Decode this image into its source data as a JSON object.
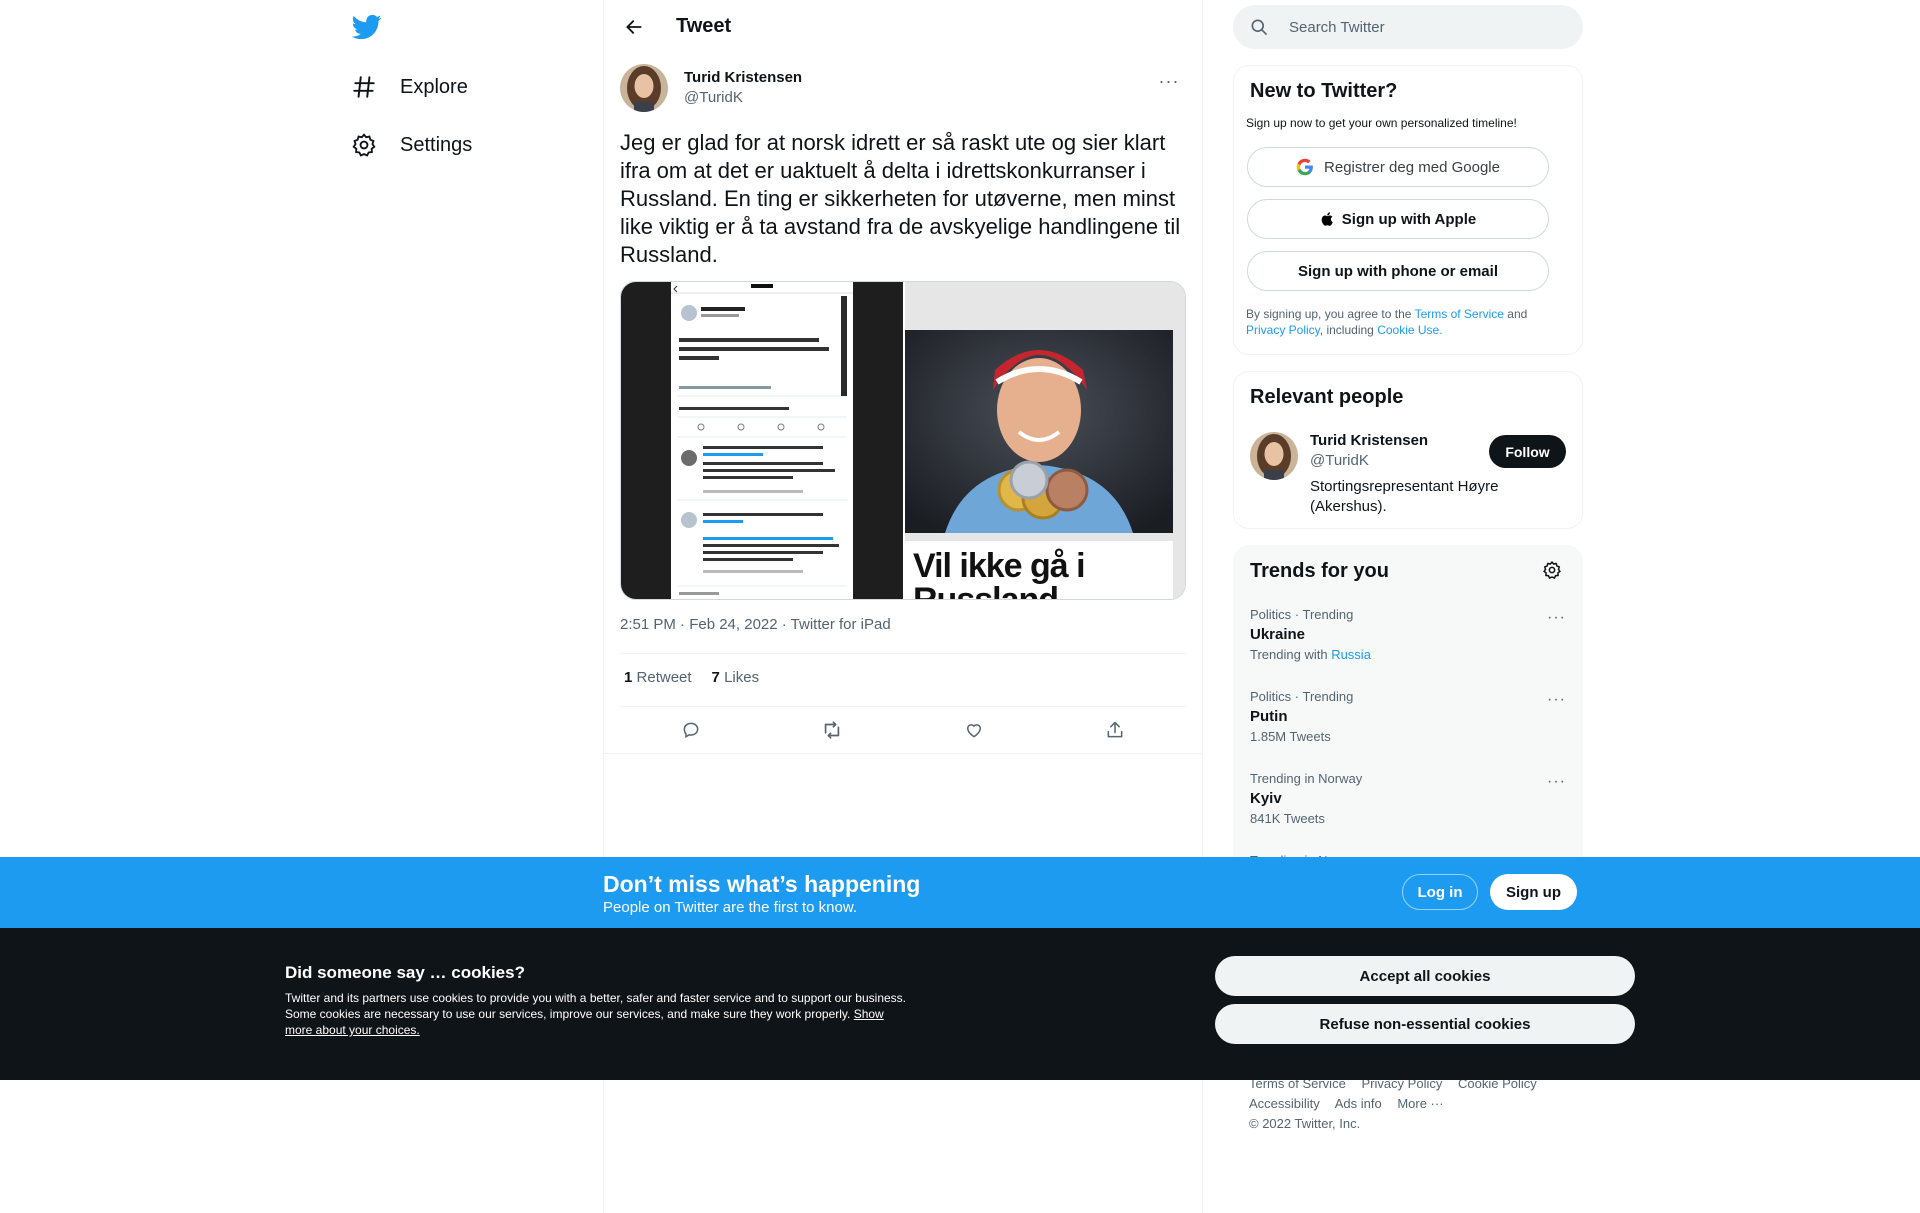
{
  "nav": {
    "logo": "twitter-bird-icon",
    "items": [
      {
        "label": "Explore",
        "icon": "hashtag-icon"
      },
      {
        "label": "Settings",
        "icon": "gear-icon"
      }
    ]
  },
  "main": {
    "title": "Tweet",
    "tweet": {
      "author_name": "Turid Kristensen",
      "author_handle": "@TuridK",
      "text": "Jeg er glad for at norsk idrett er så raskt ute og sier klart ifra om at det er uaktuelt å delta i idrettskonkurranser i Russland. En ting er sikkerheten for utøverne, men minst like viktig er å ta avstand fra de avskyelige handlingene til Russland.",
      "media_caption_line1": "Vil ikke gå i",
      "media_caption_line2": "Russland",
      "meta": "2:51 PM · Feb 24, 2022 · Twitter for iPad",
      "retweets_count": "1",
      "retweets_label": "Retweet",
      "likes_count": "7",
      "likes_label": "Likes"
    }
  },
  "sidebar": {
    "search_placeholder": "Search Twitter",
    "signup": {
      "title": "New to Twitter?",
      "subtitle": "Sign up now to get your own personalized timeline!",
      "google_label": "Registrer deg med Google",
      "apple_label": "Sign up with Apple",
      "phone_label": "Sign up with phone or email",
      "terms_prefix": "By signing up, you agree to the",
      "terms_link": "Terms of Service",
      "terms_and": "and",
      "privacy_link": "Privacy Policy",
      "including": ", including",
      "cookie_link": "Cookie Use."
    },
    "relevant": {
      "title": "Relevant people",
      "name": "Turid Kristensen",
      "handle": "@TuridK",
      "bio": "Stortingsrepresentant Høyre (Akershus).",
      "follow_label": "Follow"
    },
    "trends": {
      "title": "Trends for you",
      "items": [
        {
          "context": "Politics · Trending",
          "name": "Ukraine",
          "count_prefix": "Trending with",
          "count_link": "Russia"
        },
        {
          "context": "Politics · Trending",
          "name": "Putin",
          "count": "1.85M Tweets"
        },
        {
          "context": "Trending in Norway",
          "name": "Kyiv",
          "count": "841K Tweets"
        },
        {
          "context": "Trending in Norway",
          "name": "",
          "count": ""
        }
      ]
    },
    "footer": {
      "terms": "Terms of Service",
      "privacy": "Privacy Policy",
      "cookie": "Cookie Policy",
      "accessibility": "Accessibility",
      "ads": "Ads info",
      "more": "More ···",
      "copyright": "© 2022 Twitter, Inc."
    }
  },
  "banner": {
    "title": "Don’t miss what’s happening",
    "subtitle": "People on Twitter are the first to know.",
    "login_label": "Log in",
    "signup_label": "Sign up"
  },
  "cookies": {
    "title": "Did someone say … cookies?",
    "body": "Twitter and its partners use cookies to provide you with a better, safer and faster service and to support our business. Some cookies are necessary to use our services, improve our services, and make sure they work properly.",
    "link": "Show more about your choices.",
    "accept_label": "Accept all cookies",
    "refuse_label": "Refuse non-essential cookies"
  },
  "colors": {
    "accent": "#1d9bf0",
    "text": "#0f1419",
    "muted": "#536471",
    "cookie_bg": "#0f1419"
  }
}
